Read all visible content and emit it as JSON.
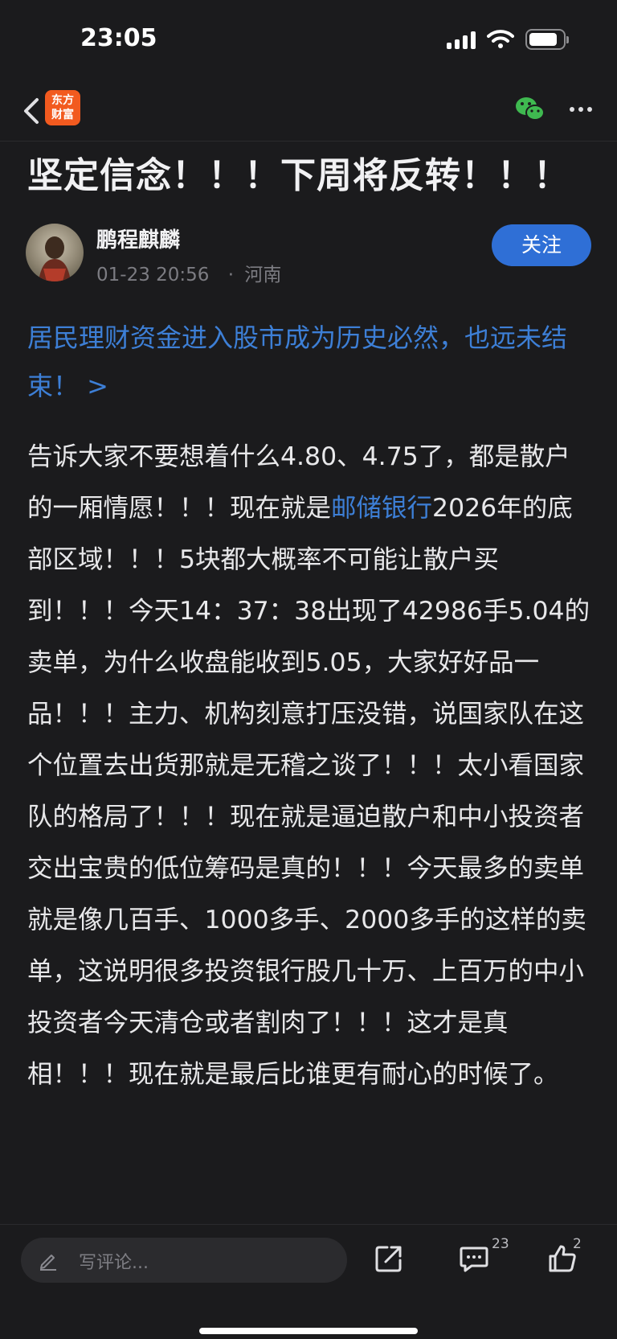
{
  "status_bar": {
    "time": "23:05",
    "battery_level": 0.85
  },
  "nav": {
    "logo_line1": "东方",
    "logo_line2": "财富"
  },
  "article": {
    "title": "坚定信念！！！下周将反转！！！",
    "author": {
      "name": "鹏程麒麟",
      "date": "01-23 20:56",
      "location_sep": "·",
      "location": "河南",
      "follow_label": "关注"
    },
    "promo_link": "居民理财资金进入股市成为历史必然，也远未结束！ >",
    "body_part1": "告诉大家不要想着什么4.80、4.75了，都是散户的一厢情愿！！！现在就是",
    "stock_link": "邮储银行",
    "body_part2": "2026年的底部区域！！！5块都大概率不可能让散户买到！！！今天14：37：38出现了42986手5.04的卖单，为什么收盘能收到5.05，大家好好品一品！！！主力、机构刻意打压没错，说国家队在这个位置去出货那就是无稽之谈了！！！太小看国家队的格局了！！！现在就是逼迫散户和中小投资者交出宝贵的低位筹码是真的！！！今天最多的卖单就是像几百手、1000多手、2000多手的这样的卖单，这说明很多投资银行股几十万、上百万的中小投资者今天清仓或者割肉了！！！这才是真相！！！现在就是最后比谁更有耐心的时候了。"
  },
  "bottom_bar": {
    "comment_placeholder": "写评论...",
    "comment_count": "23",
    "like_count": "2"
  },
  "icons": {
    "back": "chevron-left-icon",
    "share": "share-icon",
    "wechat": "wechat-icon",
    "more": "more-icon",
    "comment": "comment-icon",
    "like": "thumbs-up-icon",
    "edit": "pen-icon"
  },
  "colors": {
    "accent": "#3d7fd6",
    "follow_button": "#2f6fd6",
    "logo": "#f25a1f",
    "background": "#1b1b1d"
  }
}
